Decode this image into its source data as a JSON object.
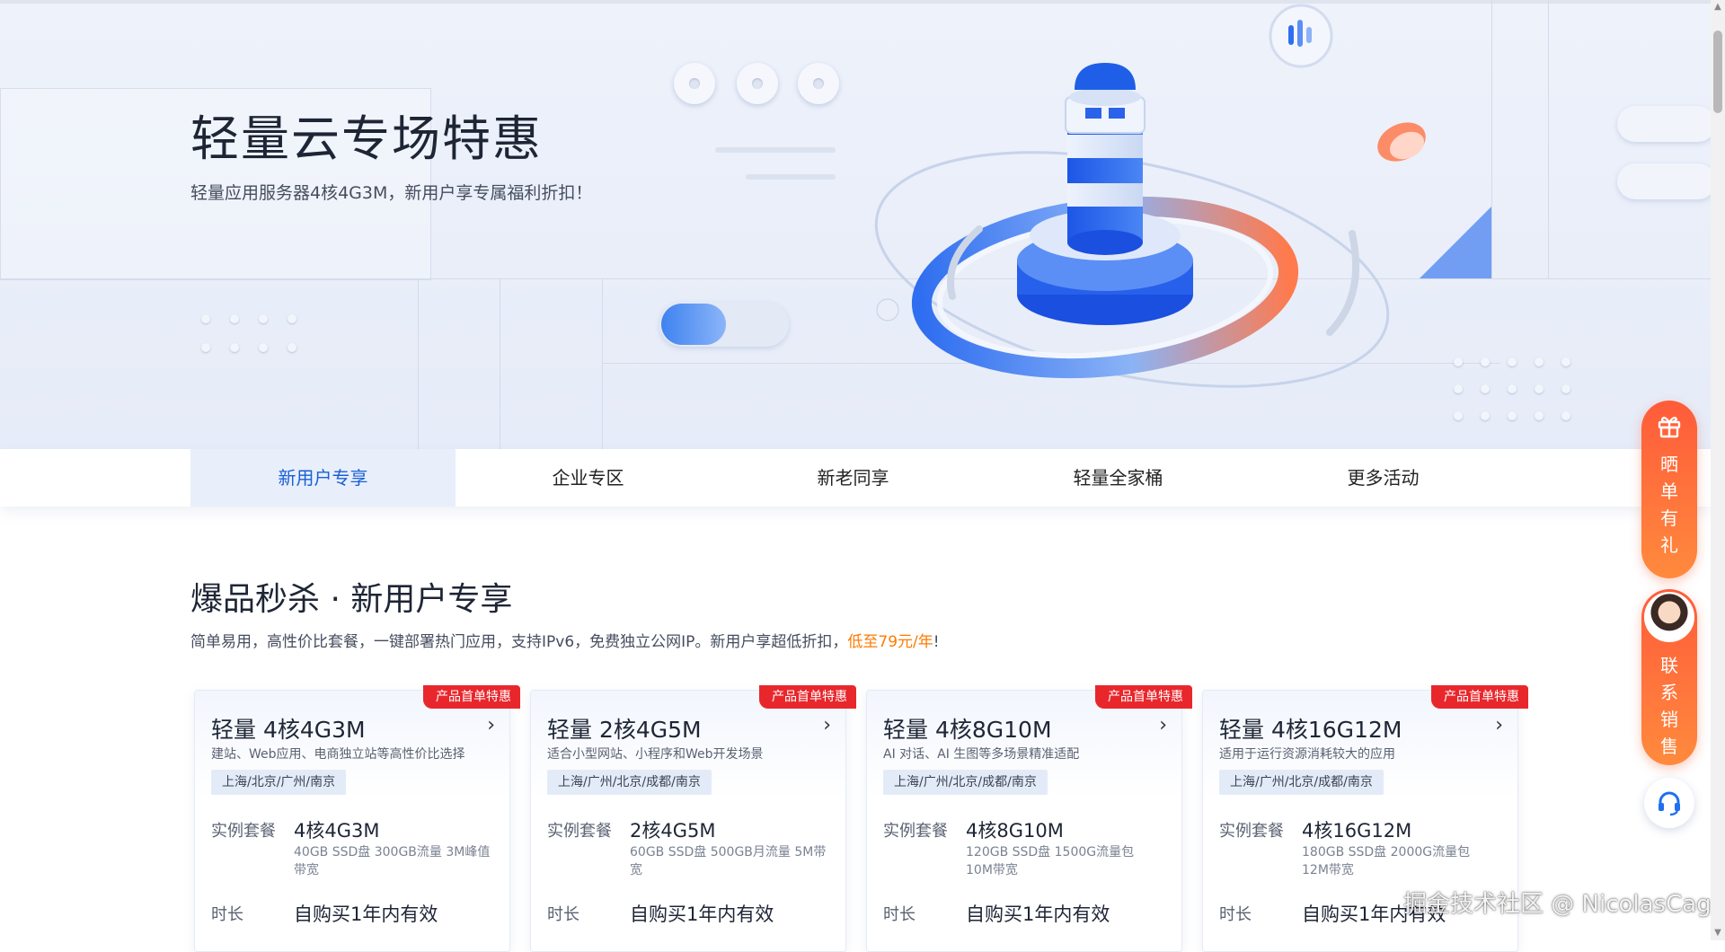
{
  "hero": {
    "title": "轻量云专场特惠",
    "subtitle": "轻量应用服务器4核4G3M，新用户享专属福利折扣！"
  },
  "tabs": [
    {
      "label": "新用户专享",
      "active": true
    },
    {
      "label": "企业专区",
      "active": false
    },
    {
      "label": "新老同享",
      "active": false
    },
    {
      "label": "轻量全家桶",
      "active": false
    },
    {
      "label": "更多活动",
      "active": false
    }
  ],
  "section": {
    "title": "爆品秒杀 · 新用户专享",
    "desc_prefix": "简单易用，高性价比套餐，一键部署热门应用，支持IPv6，免费独立公网IP。新用户享超低折扣，",
    "desc_highlight": "低至79元/年",
    "desc_suffix": "!"
  },
  "cards": [
    {
      "badge": "产品首单特惠",
      "title": "轻量 4核4G3M",
      "desc": "建站、Web应用、电商独立站等高性价比选择",
      "regions": "上海/北京/广州/南京",
      "spec_label": "实例套餐",
      "spec_value": "4核4G3M",
      "spec_detail": "40GB SSD盘 300GB流量 3M峰值带宽",
      "duration_label": "时长",
      "duration_value": "自购买1年内有效"
    },
    {
      "badge": "产品首单特惠",
      "title": "轻量 2核4G5M",
      "desc": "适合小型网站、小程序和Web开发场景",
      "regions": "上海/广州/北京/成都/南京",
      "spec_label": "实例套餐",
      "spec_value": "2核4G5M",
      "spec_detail": "60GB SSD盘 500GB月流量 5M带宽",
      "duration_label": "时长",
      "duration_value": "自购买1年内有效"
    },
    {
      "badge": "产品首单特惠",
      "title": "轻量 4核8G10M",
      "desc": "AI 对话、AI 生图等多场景精准适配",
      "regions": "上海/广州/北京/成都/南京",
      "spec_label": "实例套餐",
      "spec_value": "4核8G10M",
      "spec_detail": "120GB SSD盘 1500G流量包 10M带宽",
      "duration_label": "时长",
      "duration_value": "自购买1年内有效"
    },
    {
      "badge": "产品首单特惠",
      "title": "轻量 4核16G12M",
      "desc": "适用于运行资源消耗较大的应用",
      "regions": "上海/广州/北京/成都/南京",
      "spec_label": "实例套餐",
      "spec_value": "4核16G12M",
      "spec_detail": "180GB SSD盘 2000G流量包 12M带宽",
      "duration_label": "时长",
      "duration_value": "自购买1年内有效"
    }
  ],
  "float": {
    "gift_text": [
      "晒",
      "单",
      "有",
      "礼"
    ],
    "sales_text": [
      "联",
      "系",
      "销",
      "售"
    ],
    "icons": [
      "gift-icon",
      "avatar",
      "headset-icon"
    ]
  },
  "watermark": "掘金技术社区 @ NicolasCage",
  "colors": {
    "accent_blue": "#1a5fd6",
    "active_tab_bg": "#e8effb",
    "badge_red": "#e8272c",
    "price_orange": "#ff7a00",
    "float_orange": "#ff6a3d"
  }
}
